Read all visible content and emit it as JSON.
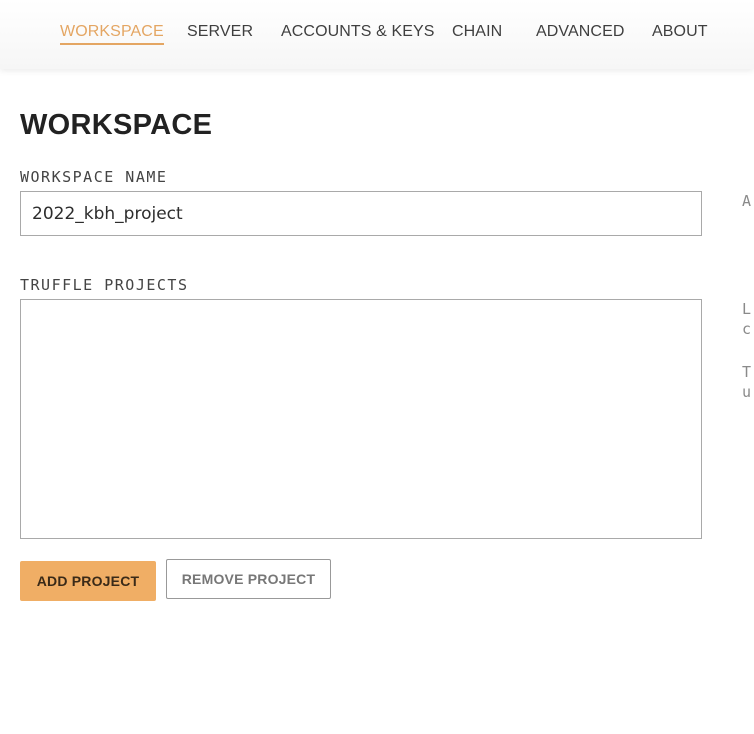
{
  "nav": {
    "tabs": [
      {
        "label": "WORKSPACE",
        "active": true
      },
      {
        "label": "SERVER",
        "active": false
      },
      {
        "label": "ACCOUNTS & KEYS",
        "active": false
      },
      {
        "label": "CHAIN",
        "active": false
      },
      {
        "label": "ADVANCED",
        "active": false
      },
      {
        "label": "ABOUT",
        "active": false
      }
    ]
  },
  "page": {
    "title": "WORKSPACE"
  },
  "workspace_name": {
    "label": "WORKSPACE NAME",
    "value": "2022_kbh_project"
  },
  "truffle_projects": {
    "label": "TRUFFLE PROJECTS",
    "items": []
  },
  "buttons": {
    "add_project": "ADD PROJECT",
    "remove_project": "REMOVE PROJECT"
  },
  "side_help": {
    "line1": "A",
    "line2": "L",
    "line3": "c",
    "line4": "T",
    "line5": "u"
  },
  "colors": {
    "accent": "#e4a663",
    "button_primary": "#f0ae65"
  }
}
